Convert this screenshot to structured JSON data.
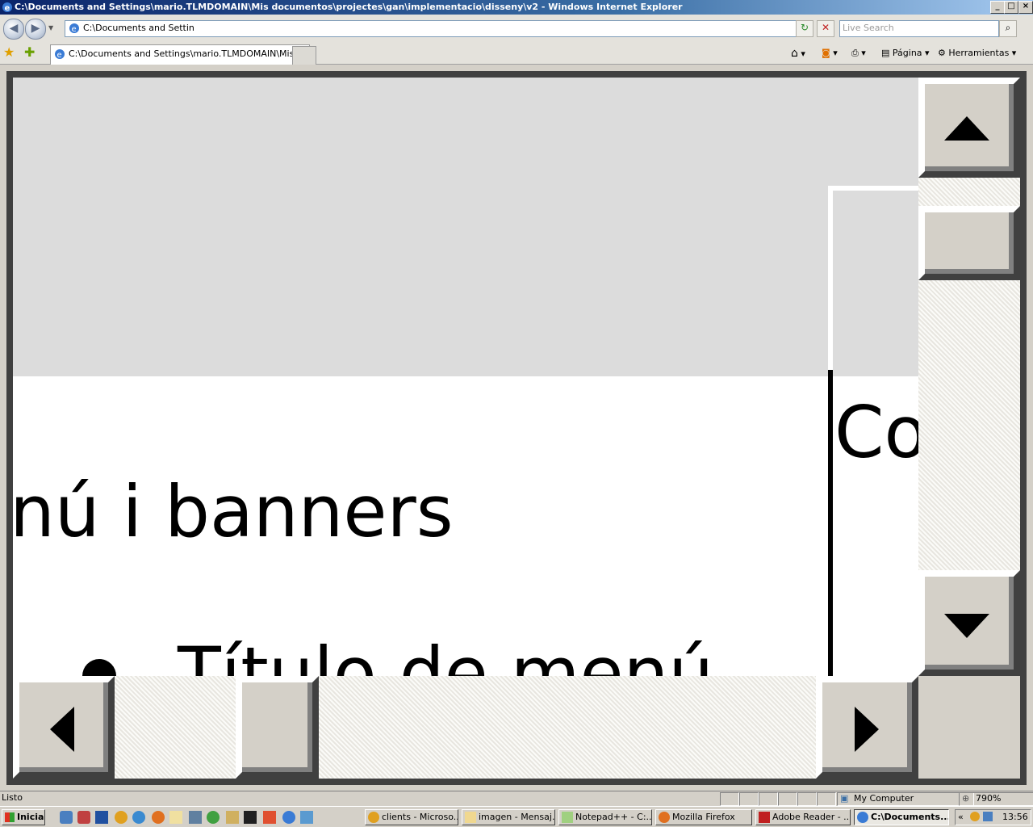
{
  "window": {
    "title": "C:\\Documents and Settings\\mario.TLMDOMAIN\\Mis documentos\\projectes\\gan\\implementacio\\disseny\\v2 - Windows Internet Explorer",
    "minimize": "_",
    "maximize": "□",
    "close": "×"
  },
  "addressbar": {
    "url": "C:\\Documents and Settin",
    "refresh": "↻",
    "stop": "✕",
    "search_placeholder": "Live Search",
    "search_button": "⌕"
  },
  "tabs": {
    "active_label": "C:\\Documents and Settings\\mario.TLMDOMAIN\\Mis do..."
  },
  "commandbar": {
    "page_label": "Página",
    "tools_label": "Herramientas"
  },
  "content": {
    "heading": "enú  i banners",
    "right_label": "Co",
    "menu_title": "Título de menú"
  },
  "statusbar": {
    "text": "Listo",
    "zone": "My Computer",
    "zoom": "790%"
  },
  "taskbar": {
    "start_label": "Inicia",
    "tasks": [
      {
        "label": "clients - Microso..."
      },
      {
        "label": "imagen - Mensaj..."
      },
      {
        "label": "Notepad++ - C:..."
      },
      {
        "label": "Mozilla Firefox"
      },
      {
        "label": "Adobe Reader - ..."
      },
      {
        "label": "C:\\Documents..."
      }
    ],
    "clock": "13:56"
  }
}
